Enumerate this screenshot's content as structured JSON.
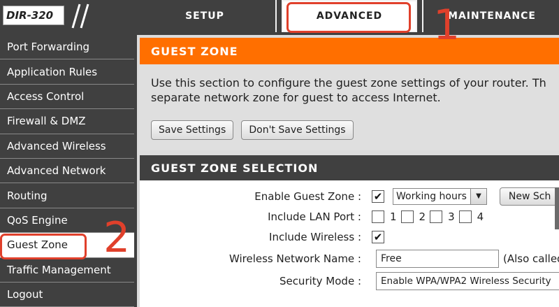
{
  "header": {
    "logo": "DIR-320",
    "tabs": [
      {
        "label": "SETUP",
        "active": false
      },
      {
        "label": "ADVANCED",
        "active": true
      },
      {
        "label": "MAINTENANCE",
        "active": false
      }
    ]
  },
  "annotations": {
    "marker_1": "1",
    "marker_2": "2",
    "color": "#e0402b"
  },
  "sidebar": {
    "items": [
      {
        "label": "Port Forwarding"
      },
      {
        "label": "Application Rules"
      },
      {
        "label": "Access Control"
      },
      {
        "label": "Firewall & DMZ"
      },
      {
        "label": "Advanced Wireless"
      },
      {
        "label": "Advanced Network"
      },
      {
        "label": "Routing"
      },
      {
        "label": "QoS Engine"
      },
      {
        "label": "Guest Zone",
        "active": true
      },
      {
        "label": "Traffic Management"
      },
      {
        "label": "Logout"
      }
    ]
  },
  "guest_zone": {
    "title": "GUEST ZONE",
    "description_line1": "Use this section to configure the guest zone settings of your router. Th",
    "description_line2": "separate network zone for guest to access Internet.",
    "save_label": "Save Settings",
    "dont_save_label": "Don't Save Settings"
  },
  "selection": {
    "title": "GUEST ZONE SELECTION",
    "enable_label": "Enable Guest Zone :",
    "enable_checked": true,
    "schedule_value": "Working hours",
    "new_schedule_label": "New Sch",
    "lan_label": "Include LAN Port :",
    "lan_ports": [
      "1",
      "2",
      "3",
      "4"
    ],
    "wireless_label": "Include Wireless :",
    "wireless_checked": true,
    "name_label": "Wireless Network Name :",
    "name_value": "Free",
    "name_hint": "(Also called",
    "security_label": "Security Mode :",
    "security_value": "Enable WPA/WPA2 Wireless Security"
  },
  "colors": {
    "accent_orange": "#ff6f00",
    "dark_bg": "#404040"
  }
}
